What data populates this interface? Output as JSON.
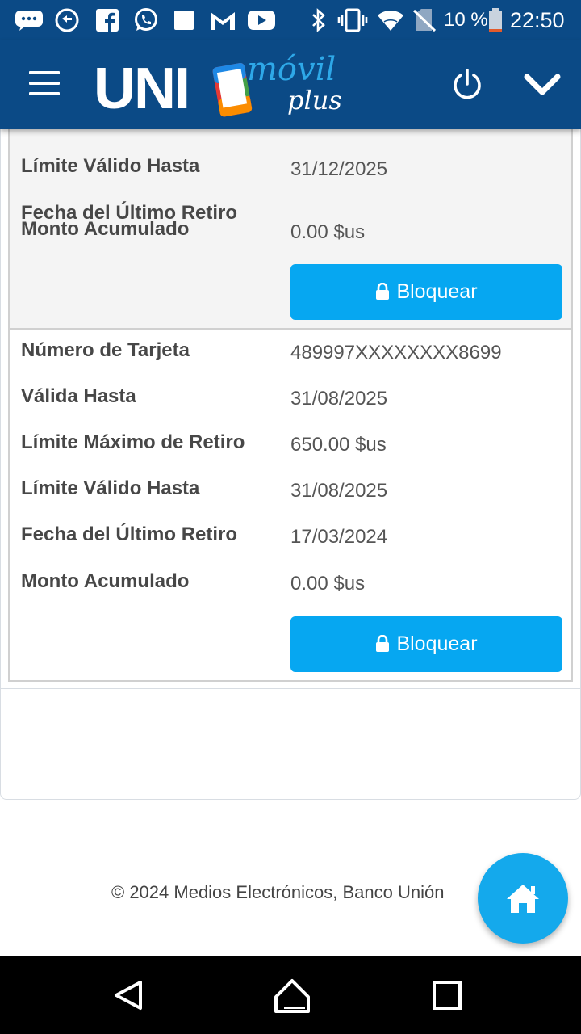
{
  "status_bar": {
    "battery": "10 %",
    "time": "22:50",
    "icons": [
      "messages-icon",
      "sync-icon",
      "facebook-icon",
      "whatsapp-icon",
      "square-icon",
      "gmail-icon",
      "youtube-icon",
      "bluetooth-icon",
      "vibrate-icon",
      "wifi-icon",
      "no-sim-icon",
      "battery-icon"
    ]
  },
  "header": {
    "logo_uni": "UNI",
    "logo_movil": "móvil",
    "logo_plus": "plus",
    "icons": [
      "menu-icon",
      "power-icon",
      "chevron-down-icon"
    ]
  },
  "cards": [
    {
      "partial_value": "000.00 $us",
      "rows": [
        {
          "label": "Límite Válido Hasta",
          "value": "31/12/2025"
        },
        {
          "label": "Fecha del Último Retiro",
          "value": ""
        },
        {
          "label": "Monto Acumulado",
          "value": "0.00 $us"
        }
      ],
      "button": "Bloquear"
    },
    {
      "rows": [
        {
          "label": "Número de Tarjeta",
          "value": "489997XXXXXXXX8699"
        },
        {
          "label": "Válida Hasta",
          "value": "31/08/2025"
        },
        {
          "label": "Límite Máximo de Retiro",
          "value": "650.00 $us"
        },
        {
          "label": "Límite Válido Hasta",
          "value": "31/08/2025"
        },
        {
          "label": "Fecha del Último Retiro",
          "value": "17/03/2024"
        },
        {
          "label": "Monto Acumulado",
          "value": "0.00 $us"
        }
      ],
      "button": "Bloquear"
    }
  ],
  "footer": {
    "text": "© 2024 Medios Electrónicos, Banco Unión"
  },
  "colors": {
    "header": "#0b4a86",
    "button": "#06a7f1",
    "fab": "#14a9ec"
  }
}
